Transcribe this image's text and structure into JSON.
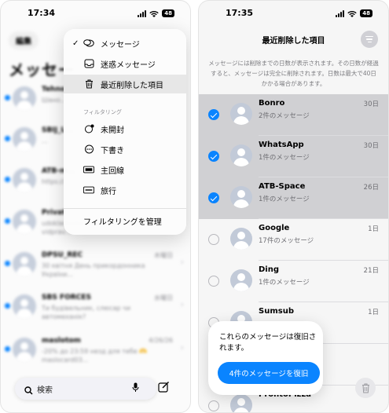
{
  "left": {
    "status": {
      "time": "17:34",
      "battery": "48"
    },
    "edit_label": "編集",
    "title": "メッセー",
    "filter_menu": {
      "items_top": [
        {
          "label": "メッセージ",
          "icon": "chat-bubbles-icon",
          "checked": true,
          "selected": false
        },
        {
          "label": "迷惑メッセージ",
          "icon": "junk-tray-icon",
          "checked": false,
          "selected": false
        },
        {
          "label": "最近削除した項目",
          "icon": "trash-icon",
          "checked": false,
          "selected": true
        }
      ],
      "section_label": "フィルタリング",
      "items_filter": [
        {
          "label": "未開封",
          "icon": "unread-bubble-icon"
        },
        {
          "label": "下書き",
          "icon": "draft-bubble-icon"
        },
        {
          "label": "主回線",
          "icon": "sim-card-icon"
        },
        {
          "label": "旅行",
          "icon": "travel-badge-icon"
        }
      ],
      "manage_label": "フィルタリングを管理"
    },
    "conversations": [
      {
        "name": "Tehno...",
        "preview": "Шано...",
        "date": "",
        "unread": true
      },
      {
        "name": "SBIJ_L...",
        "preview": "...",
        "date": "",
        "unread": true
      },
      {
        "name": "ATB-m...",
        "preview": "https://...",
        "date": "",
        "unread": true
      },
      {
        "name": "Privat",
        "preview": "udokladnishe elektronnogo zmisty vidprav...",
        "date": "",
        "unread": true
      },
      {
        "name": "DPSU_REC",
        "preview": "30 квітня День прикордонника України...",
        "date": "木曜日",
        "unread": true
      },
      {
        "name": "SBS FORCES",
        "preview": "Ти будівельник, слюсар чи автомеханік?",
        "date": "水曜日",
        "unread": true
      },
      {
        "name": "maslotom",
        "preview": "-20% до 23:59 незд для тебе 🫶 maslocard03...",
        "date": "4/26/26",
        "unread": true
      }
    ],
    "search_placeholder": "検索"
  },
  "right": {
    "status": {
      "time": "17:35",
      "battery": "48"
    },
    "title": "最近削除した項目",
    "info_text": "メッセージには削除までの日数が表示されます。その日数が経過すると、メッセージは完全に削除されます。日数は最大で40日かかる場合があります。",
    "items": [
      {
        "name": "Bonro",
        "count": "2件のメッセージ",
        "days": "30日",
        "selected": true
      },
      {
        "name": "WhatsApp",
        "count": "1件のメッセージ",
        "days": "30日",
        "selected": true
      },
      {
        "name": "ATB-Space",
        "count": "1件のメッセージ",
        "days": "26日",
        "selected": true
      },
      {
        "name": "Google",
        "count": "17件のメッセージ",
        "days": "1日",
        "selected": false
      },
      {
        "name": "Ding",
        "count": "1件のメッセージ",
        "days": "21日",
        "selected": false
      },
      {
        "name": "Sumsub",
        "count": "",
        "days": "1日",
        "selected": false
      },
      {
        "name": "",
        "count": "",
        "days": "",
        "selected": false
      },
      {
        "name": "ProntoPizza",
        "count": "",
        "days": "",
        "selected": false
      }
    ],
    "restore_text": "これらのメッセージは復旧されます。",
    "restore_button": "4件のメッセージを復旧"
  }
}
